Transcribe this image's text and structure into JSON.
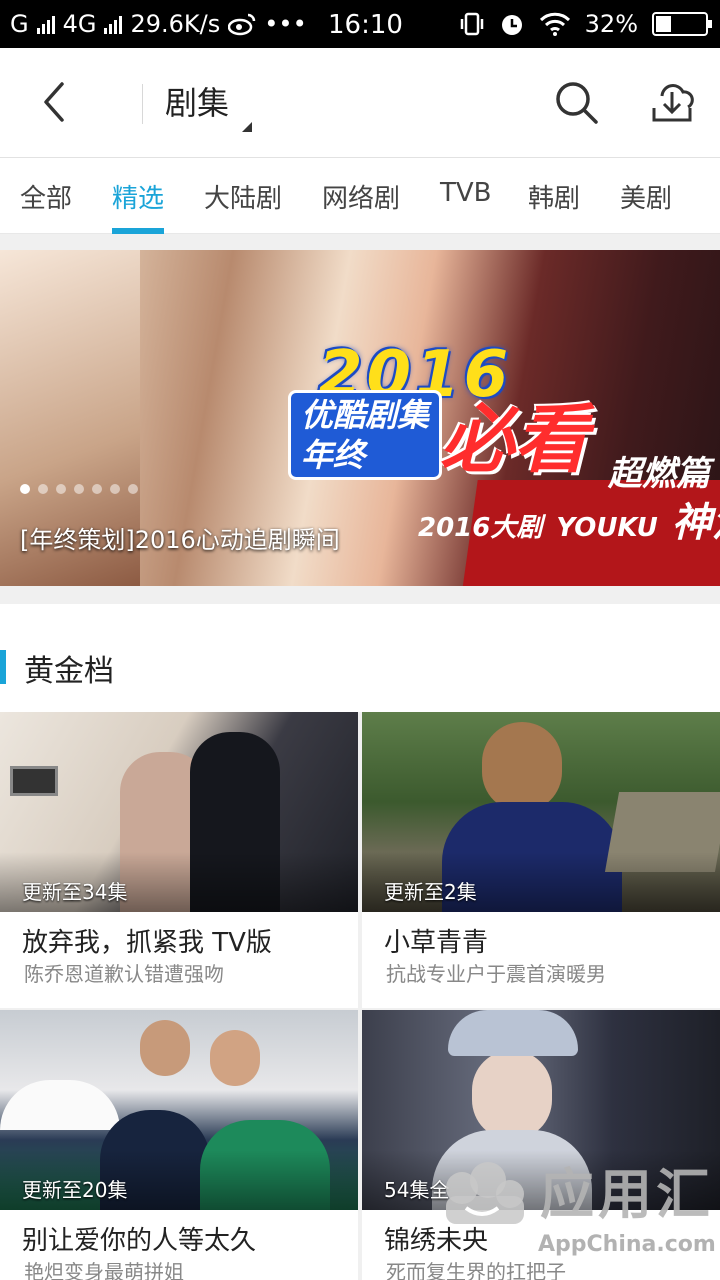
{
  "status_bar": {
    "carrier": "G",
    "network": "4G",
    "speed": "29.6K/s",
    "more": "•••",
    "time": "16:10",
    "battery": "32%",
    "battery_level": 0.32
  },
  "nav": {
    "title": "剧集"
  },
  "tabs": [
    {
      "label": "全部",
      "active": false
    },
    {
      "label": "精选",
      "active": true
    },
    {
      "label": "大陆剧",
      "active": false
    },
    {
      "label": "网络剧",
      "active": false
    },
    {
      "label": "TVB",
      "active": false
    },
    {
      "label": "韩剧",
      "active": false
    },
    {
      "label": "美剧",
      "active": false
    }
  ],
  "banner": {
    "caption": "[年终策划]2016心动追剧瞬间",
    "promo_year": "2016",
    "promo_sub": "优酷剧集\n年终",
    "promo_big": "必看",
    "promo_hot": "超燃篇",
    "promo_mix_prefix": "2016大剧",
    "promo_mix_brand": "YOUKU",
    "promo_mix_suffix": "神混剪",
    "active_slide": 0
  },
  "section": {
    "title": "黄金档"
  },
  "cards": [
    {
      "episode": "更新至34集",
      "title": "放弃我，抓紧我 TV版",
      "desc": "陈乔恩道歉认错遭强吻"
    },
    {
      "episode": "更新至2集",
      "title": "小草青青",
      "desc": "抗战专业户于震首演暖男"
    },
    {
      "episode": "更新至20集",
      "title": "别让爱你的人等太久",
      "desc": "艳炟变身最萌拼姐"
    },
    {
      "episode": "54集全",
      "title": "锦绣未央",
      "desc": "死而复生界的扛把子"
    }
  ],
  "watermark": {
    "text": "应用汇",
    "site": "AppChina.com"
  },
  "colors": {
    "accent": "#1aa4d8",
    "status_bg": "#000000"
  }
}
